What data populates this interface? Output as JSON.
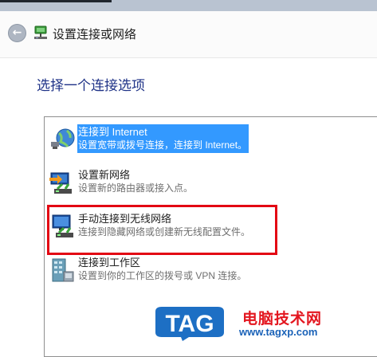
{
  "window": {
    "title": "设置连接或网络"
  },
  "page": {
    "heading": "选择一个连接选项"
  },
  "options": [
    {
      "label": "连接到 Internet",
      "description": "设置宽带或拨号连接，连接到 Internet。",
      "icon": "globe-internet-icon",
      "selected": true
    },
    {
      "label": "设置新网络",
      "description": "设置新的路由器或接入点。",
      "icon": "new-network-router-icon",
      "selected": false
    },
    {
      "label": "手动连接到无线网络",
      "description": "连接到隐藏网络或创建新无线配置文件。",
      "icon": "wireless-network-icon",
      "selected": false,
      "highlighted": true
    },
    {
      "label": "连接到工作区",
      "description": "设置到你的工作区的拨号或 VPN 连接。",
      "icon": "workplace-connection-icon",
      "selected": false
    }
  ],
  "watermark": {
    "logo": "TAG",
    "site_name": "电脑技术网",
    "url": "www.tagxp.com"
  },
  "colors": {
    "heading": "#1e3287",
    "selection": "#3399ff",
    "highlight_box": "#e30613"
  }
}
